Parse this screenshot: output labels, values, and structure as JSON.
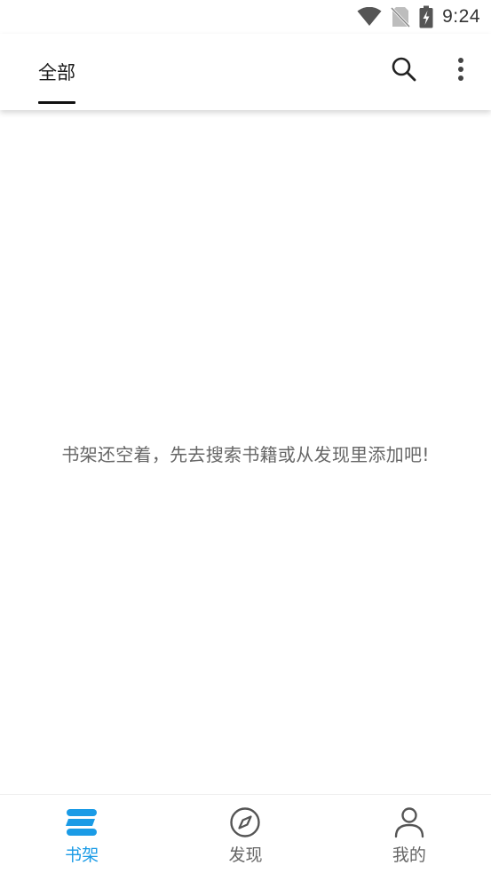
{
  "status_bar": {
    "time": "9:24",
    "icons": [
      "wifi-icon",
      "no-sim-icon",
      "battery-charging-icon"
    ]
  },
  "top_bar": {
    "tab_label": "全部",
    "actions": [
      "search-icon",
      "more-vert-icon"
    ]
  },
  "content": {
    "empty_message": "书架还空着，先去搜索书籍或从发现里添加吧!"
  },
  "bottom_nav": {
    "items": [
      {
        "label": "书架",
        "icon": "bookshelf-icon",
        "active": true
      },
      {
        "label": "发现",
        "icon": "compass-icon",
        "active": false
      },
      {
        "label": "我的",
        "icon": "person-icon",
        "active": false
      }
    ]
  },
  "colors": {
    "accent": "#1a9be6",
    "inactive": "#666666",
    "indicator": "#111111"
  }
}
